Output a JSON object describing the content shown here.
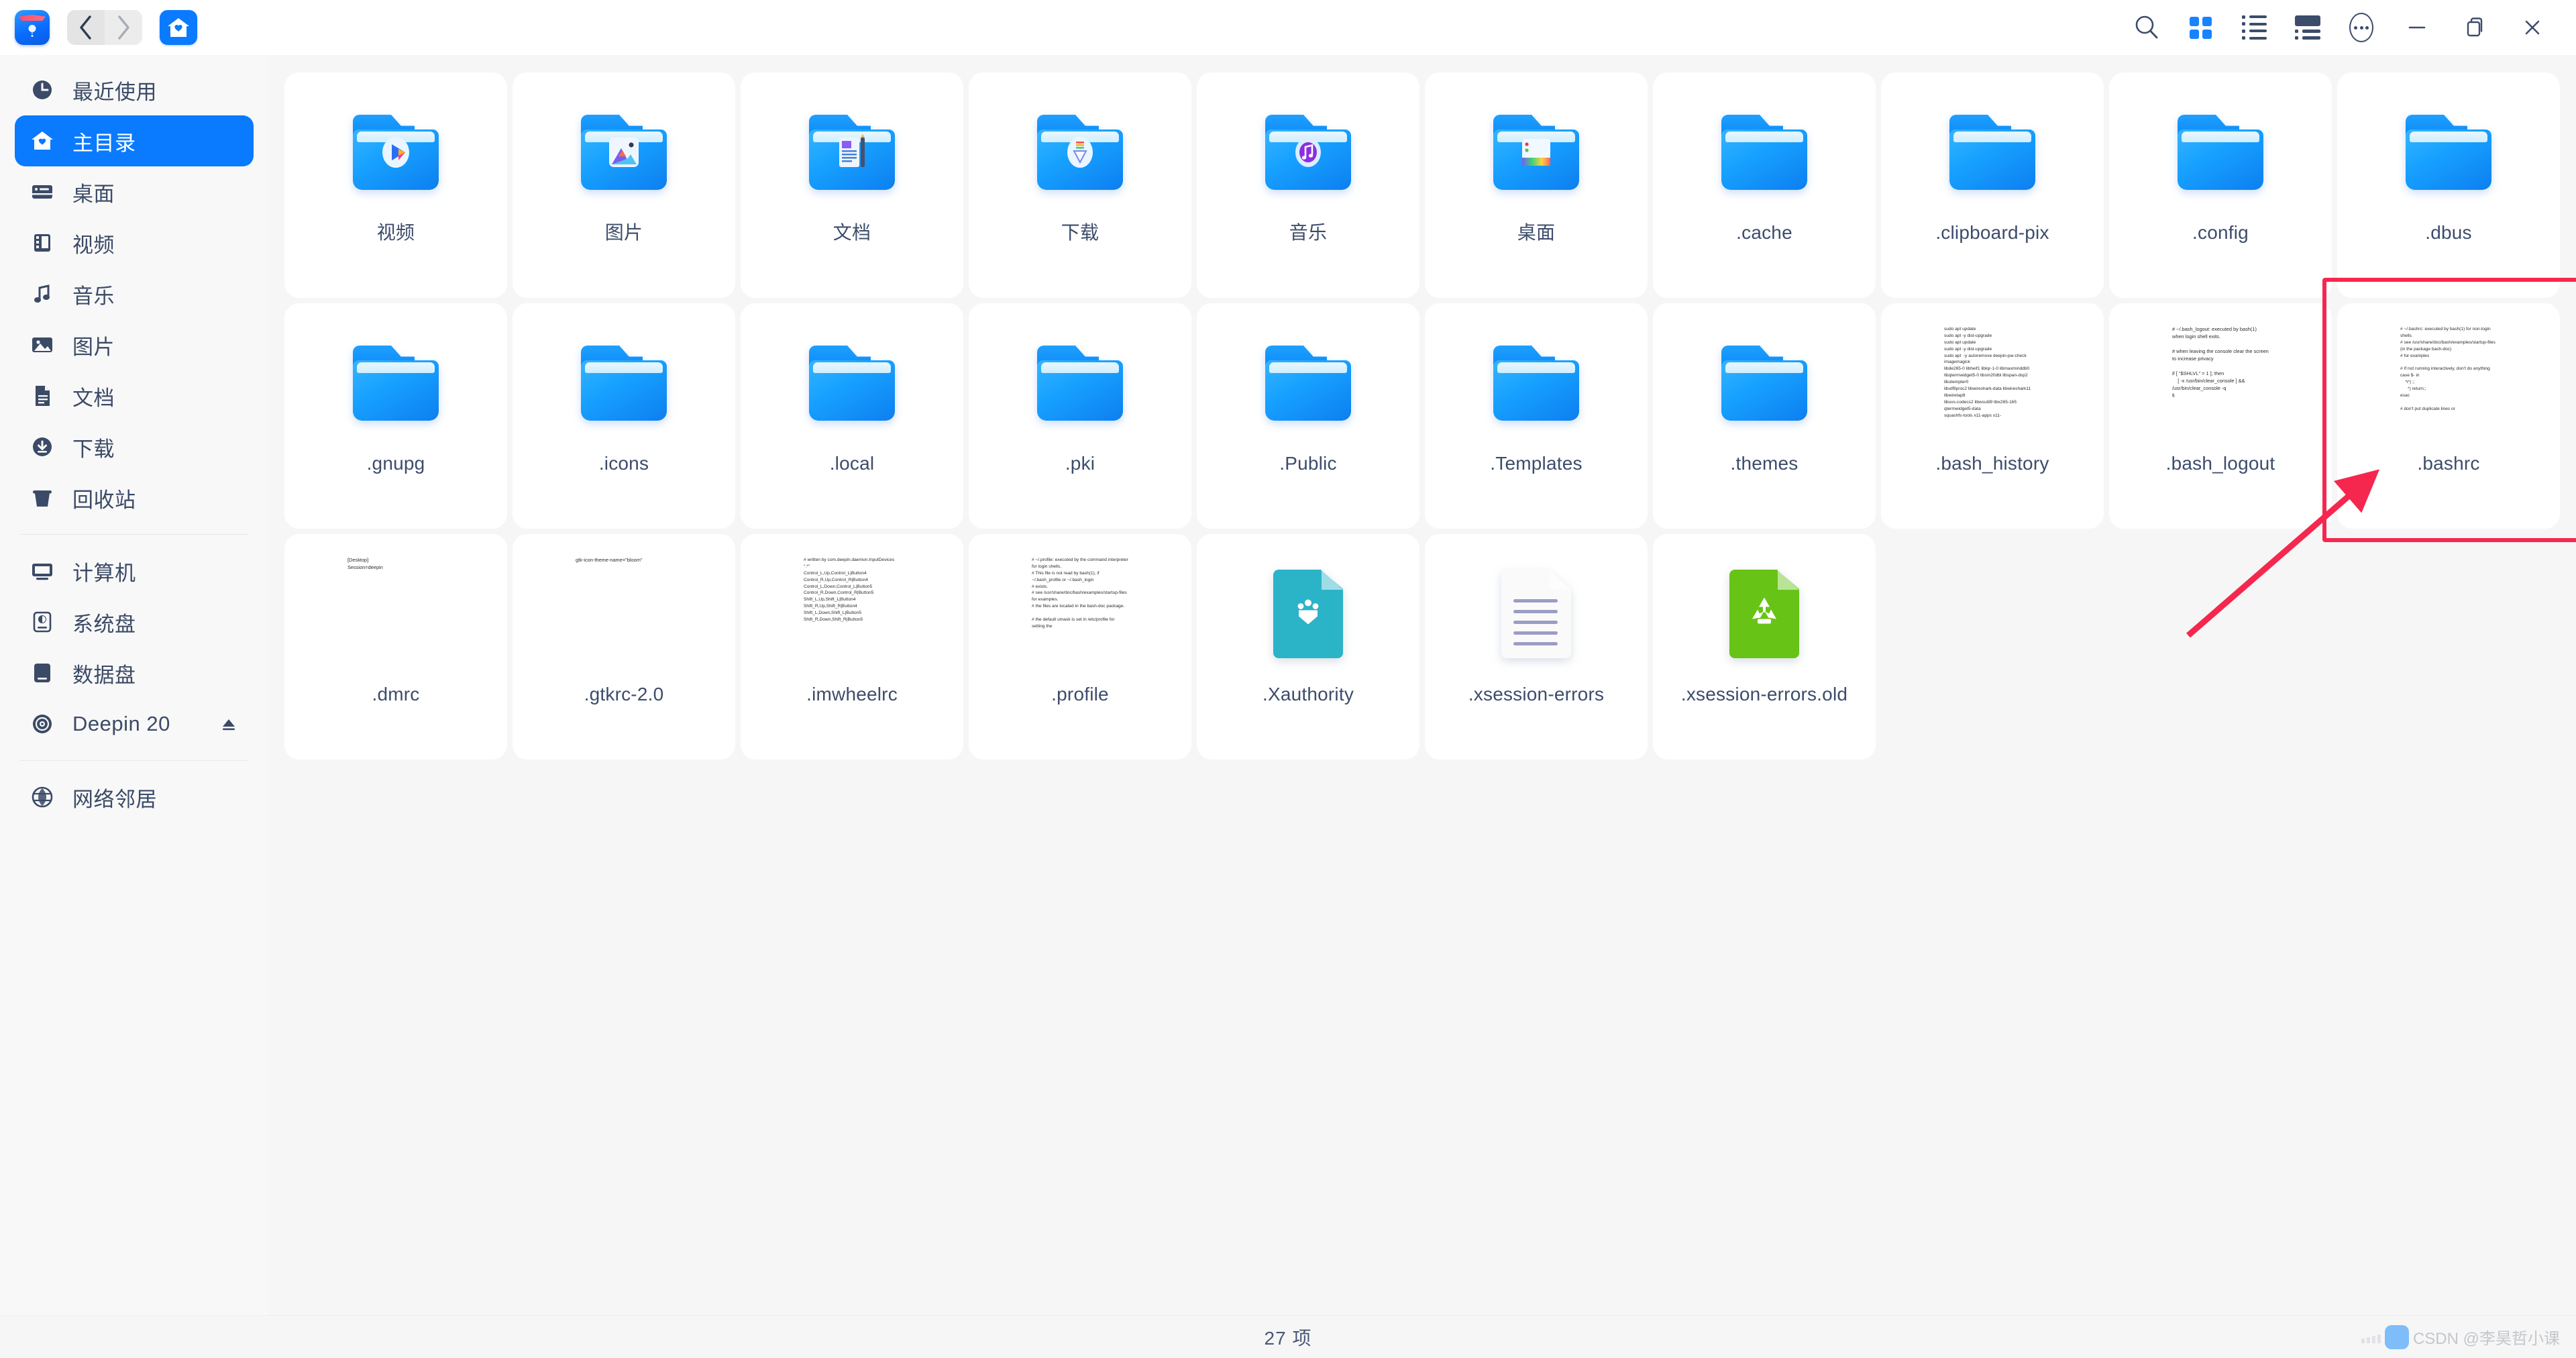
{
  "window": {
    "app_icon": "deepin-file-manager-icon",
    "nav": {
      "back": "back-icon",
      "forward": "forward-icon",
      "home": "home-icon"
    },
    "toolbar": [
      {
        "name": "search-button",
        "icon": "search-icon"
      },
      {
        "name": "icon-view-button",
        "icon": "grid-view-icon",
        "active": true
      },
      {
        "name": "list-view-button",
        "icon": "list-view-icon",
        "active": false
      },
      {
        "name": "detail-view-button",
        "icon": "detail-view-icon",
        "active": false
      },
      {
        "name": "more-options-button",
        "icon": "ellipsis-icon"
      }
    ],
    "controls": [
      {
        "name": "minimize-button",
        "icon": "minimize-icon"
      },
      {
        "name": "maximize-button",
        "icon": "restore-icon"
      },
      {
        "name": "close-button",
        "icon": "close-icon"
      }
    ]
  },
  "sidebar": {
    "groups": [
      {
        "items": [
          {
            "label": "最近使用",
            "icon": "clock-icon",
            "active": false
          },
          {
            "label": "主目录",
            "icon": "home-icon",
            "active": true
          },
          {
            "label": "桌面",
            "icon": "desktop-icon",
            "active": false
          },
          {
            "label": "视频",
            "icon": "film-icon",
            "active": false
          },
          {
            "label": "音乐",
            "icon": "music-note-icon",
            "active": false
          },
          {
            "label": "图片",
            "icon": "image-icon",
            "active": false
          },
          {
            "label": "文档",
            "icon": "document-icon",
            "active": false
          },
          {
            "label": "下载",
            "icon": "download-icon",
            "active": false
          },
          {
            "label": "回收站",
            "icon": "trash-icon",
            "active": false
          }
        ]
      },
      {
        "items": [
          {
            "label": "计算机",
            "icon": "computer-icon",
            "active": false
          },
          {
            "label": "系统盘",
            "icon": "system-disk-icon",
            "active": false
          },
          {
            "label": "数据盘",
            "icon": "data-disk-icon",
            "active": false
          },
          {
            "label": "Deepin 20",
            "icon": "disc-icon",
            "active": false,
            "eject": "eject-icon"
          }
        ]
      },
      {
        "items": [
          {
            "label": "网络邻居",
            "icon": "network-icon",
            "active": false
          }
        ]
      }
    ]
  },
  "files": [
    {
      "name": "视频",
      "type": "folder",
      "badge": "video-badge"
    },
    {
      "name": "图片",
      "type": "folder",
      "badge": "picture-badge"
    },
    {
      "name": "文档",
      "type": "folder",
      "badge": "document-badge"
    },
    {
      "name": "下载",
      "type": "folder",
      "badge": "download-badge"
    },
    {
      "name": "音乐",
      "type": "folder",
      "badge": "music-badge"
    },
    {
      "name": "桌面",
      "type": "folder",
      "badge": "desktop-badge"
    },
    {
      "name": ".cache",
      "type": "folder",
      "badge": ""
    },
    {
      "name": ".clipboard-pix",
      "type": "folder",
      "badge": ""
    },
    {
      "name": ".config",
      "type": "folder",
      "badge": ""
    },
    {
      "name": ".dbus",
      "type": "folder",
      "badge": ""
    },
    {
      "name": ".gnupg",
      "type": "folder",
      "badge": ""
    },
    {
      "name": ".icons",
      "type": "folder",
      "badge": ""
    },
    {
      "name": ".local",
      "type": "folder",
      "badge": ""
    },
    {
      "name": ".pki",
      "type": "folder",
      "badge": ""
    },
    {
      "name": ".Public",
      "type": "folder",
      "badge": ""
    },
    {
      "name": ".Templates",
      "type": "folder",
      "badge": ""
    },
    {
      "name": ".themes",
      "type": "folder",
      "badge": ""
    },
    {
      "name": ".bash_history",
      "type": "text",
      "preview": "sudo apt update\nsudo apt -y dist-upgrade\nsudo apt update\nsudo apt -y dist-upgrade\nsudo apt  -y autoremove deepin-pw-check imagemagick\nlibde265-0 libheif1 liblqr-1-0 libmaxminddb0\nlibqtermwidget5-0 libsm20dbl libspan-dsp2 libutempter0\nlibutf8proc2 libwireshark-data libwireshark11 libwiretap8\nlibuvs-codecs2 libwsutil9 libx265-165 qtermwidget5-data\nsquashfs-tools x11-apps x11-"
    },
    {
      "name": ".bash_logout",
      "type": "text",
      "preview": "# ~/.bash_logout: executed by bash(1) when login shell exits.\n\n# when leaving the console clear the screen to increase privacy\n\nif [ \"$SHLVL\" = 1 ]; then\n    [ -x /usr/bin/clear_console ] && /usr/bin/clear_console -q\nfi"
    },
    {
      "name": ".bashrc",
      "type": "text",
      "selected": true,
      "preview": "# ~/.bashrc: executed by bash(1) for non-login shells.\n# see /usr/share/doc/bash/examples/startup-files (in the package bash-doc)\n# for examples\n\n# If not running interactively, don't do anything\ncase $- in\n    *i*) ;;\n      *) return;;\nesac\n\n# don't put duplicate lines or"
    },
    {
      "name": ".dmrc",
      "type": "text",
      "preview": "[Desktop]\nSession=deepin"
    },
    {
      "name": ".gtkrc-2.0",
      "type": "text",
      "preview": "gtk-icon-theme-name=\"bloom\""
    },
    {
      "name": ".imwheelrc",
      "type": "text",
      "preview": "# written by com.deepin.daemon.InputDevices\n\".*\"\nControl_L,Up,Control_L|Button4\nControl_R,Up,Control_R|Button4\nControl_L,Down,Control_L|Button5\nControl_R,Down,Control_R|Button5\nShift_L,Up,Shift_L|Button4\nShift_R,Up,Shift_R|Button4\nShift_L,Down,Shift_L|Button5\nShift_R,Down,Shift_R|Button5"
    },
    {
      "name": ".profile",
      "type": "text",
      "preview": "# ~/.profile: executed by the command interpreter for login shells.\n# This file is not read by bash(1), if ~/.bash_profile or ~/.bash_login\n# exists.\n# see /usr/share/doc/bash/examples/startup-files for examples.\n# the files are located in the bash-doc package.\n\n# the default umask is set in /etc/profile for setting the"
    },
    {
      "name": ".Xauthority",
      "type": "file",
      "color": "#2bb3c8",
      "glyph": "auth-key-icon"
    },
    {
      "name": ".xsession-errors",
      "type": "file",
      "color": "#fafafa",
      "glyph": "text-lines-icon"
    },
    {
      "name": ".xsession-errors.old",
      "type": "file",
      "color": "#67c315",
      "glyph": "recycle-icon"
    }
  ],
  "statusbar": {
    "count_label": "27 项"
  },
  "watermark": {
    "text": "CSDN @李昊哲小课"
  },
  "annotation": {
    "highlight_target": ".bashrc",
    "rect_color": "#f5274e",
    "arrow_color": "#f5274e"
  }
}
